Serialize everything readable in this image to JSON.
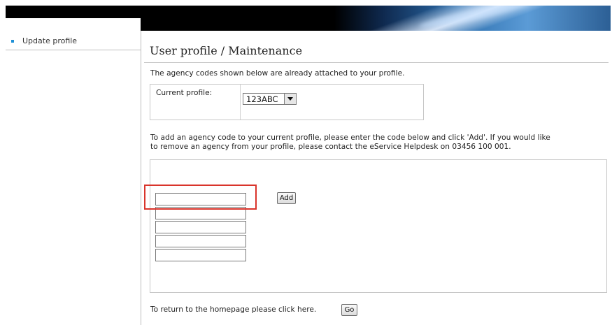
{
  "sidebar": {
    "items": [
      {
        "label": "Update profile"
      }
    ]
  },
  "main": {
    "title": "User profile / Maintenance",
    "intro": "The agency codes shown below are already attached to your profile.",
    "current_profile": {
      "label": "Current profile:",
      "selected": "123ABC"
    },
    "instructions_line1": "To add an agency code to your current profile, please enter the code below and click 'Add'. If you would like",
    "instructions_line2": "to remove an agency from your profile, please contact the eService Helpdesk on 03456 100 001.",
    "add_button_label": "Add",
    "code_inputs": [
      "",
      "",
      "",
      "",
      ""
    ],
    "return_text": "To return to the homepage please click here.",
    "go_button_label": "Go"
  },
  "colors": {
    "highlight": "#d9342b",
    "bullet": "#1e90d6"
  }
}
